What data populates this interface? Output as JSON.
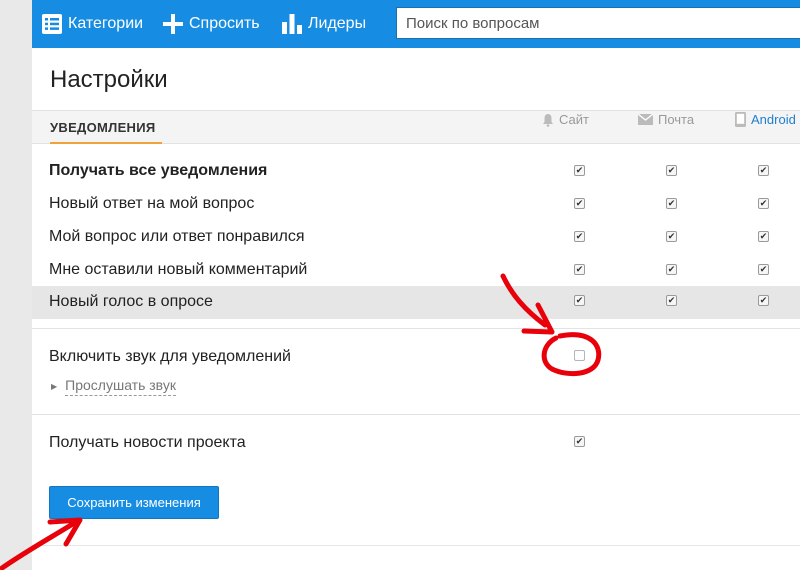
{
  "header": {
    "categories_label": "Категории",
    "ask_label": "Спросить",
    "leaders_label": "Лидеры",
    "search_placeholder": "Поиск по вопросам"
  },
  "page": {
    "title": "Настройки",
    "tab_label": "УВЕДОМЛЕНИЯ"
  },
  "columns": [
    {
      "label": "Сайт",
      "icon": "bell-icon"
    },
    {
      "label": "Почта",
      "icon": "envelope-icon"
    },
    {
      "label": "Android",
      "icon": "phone-icon"
    }
  ],
  "notifications": [
    {
      "label": "Получать все уведомления",
      "bold": true,
      "site": true,
      "mail": true,
      "android": true
    },
    {
      "label": "Новый ответ на мой вопрос",
      "site": true,
      "mail": true,
      "android": true
    },
    {
      "label": "Мой вопрос или ответ понравился",
      "site": true,
      "mail": true,
      "android": true
    },
    {
      "label": "Мне оставили новый комментарий",
      "site": true,
      "mail": true,
      "android": true
    },
    {
      "label": "Новый голос в опросе",
      "site": true,
      "mail": true,
      "android": true
    }
  ],
  "sound": {
    "label": "Включить звук для уведомлений",
    "enabled": false,
    "listen_label": "Прослушать звук"
  },
  "news": {
    "label": "Получать новости проекта",
    "enabled": true
  },
  "save_label": "Сохранить изменения",
  "colors": {
    "brand": "#168de2",
    "tab_underline": "#f0a33a",
    "annotation": "#e8000b"
  }
}
